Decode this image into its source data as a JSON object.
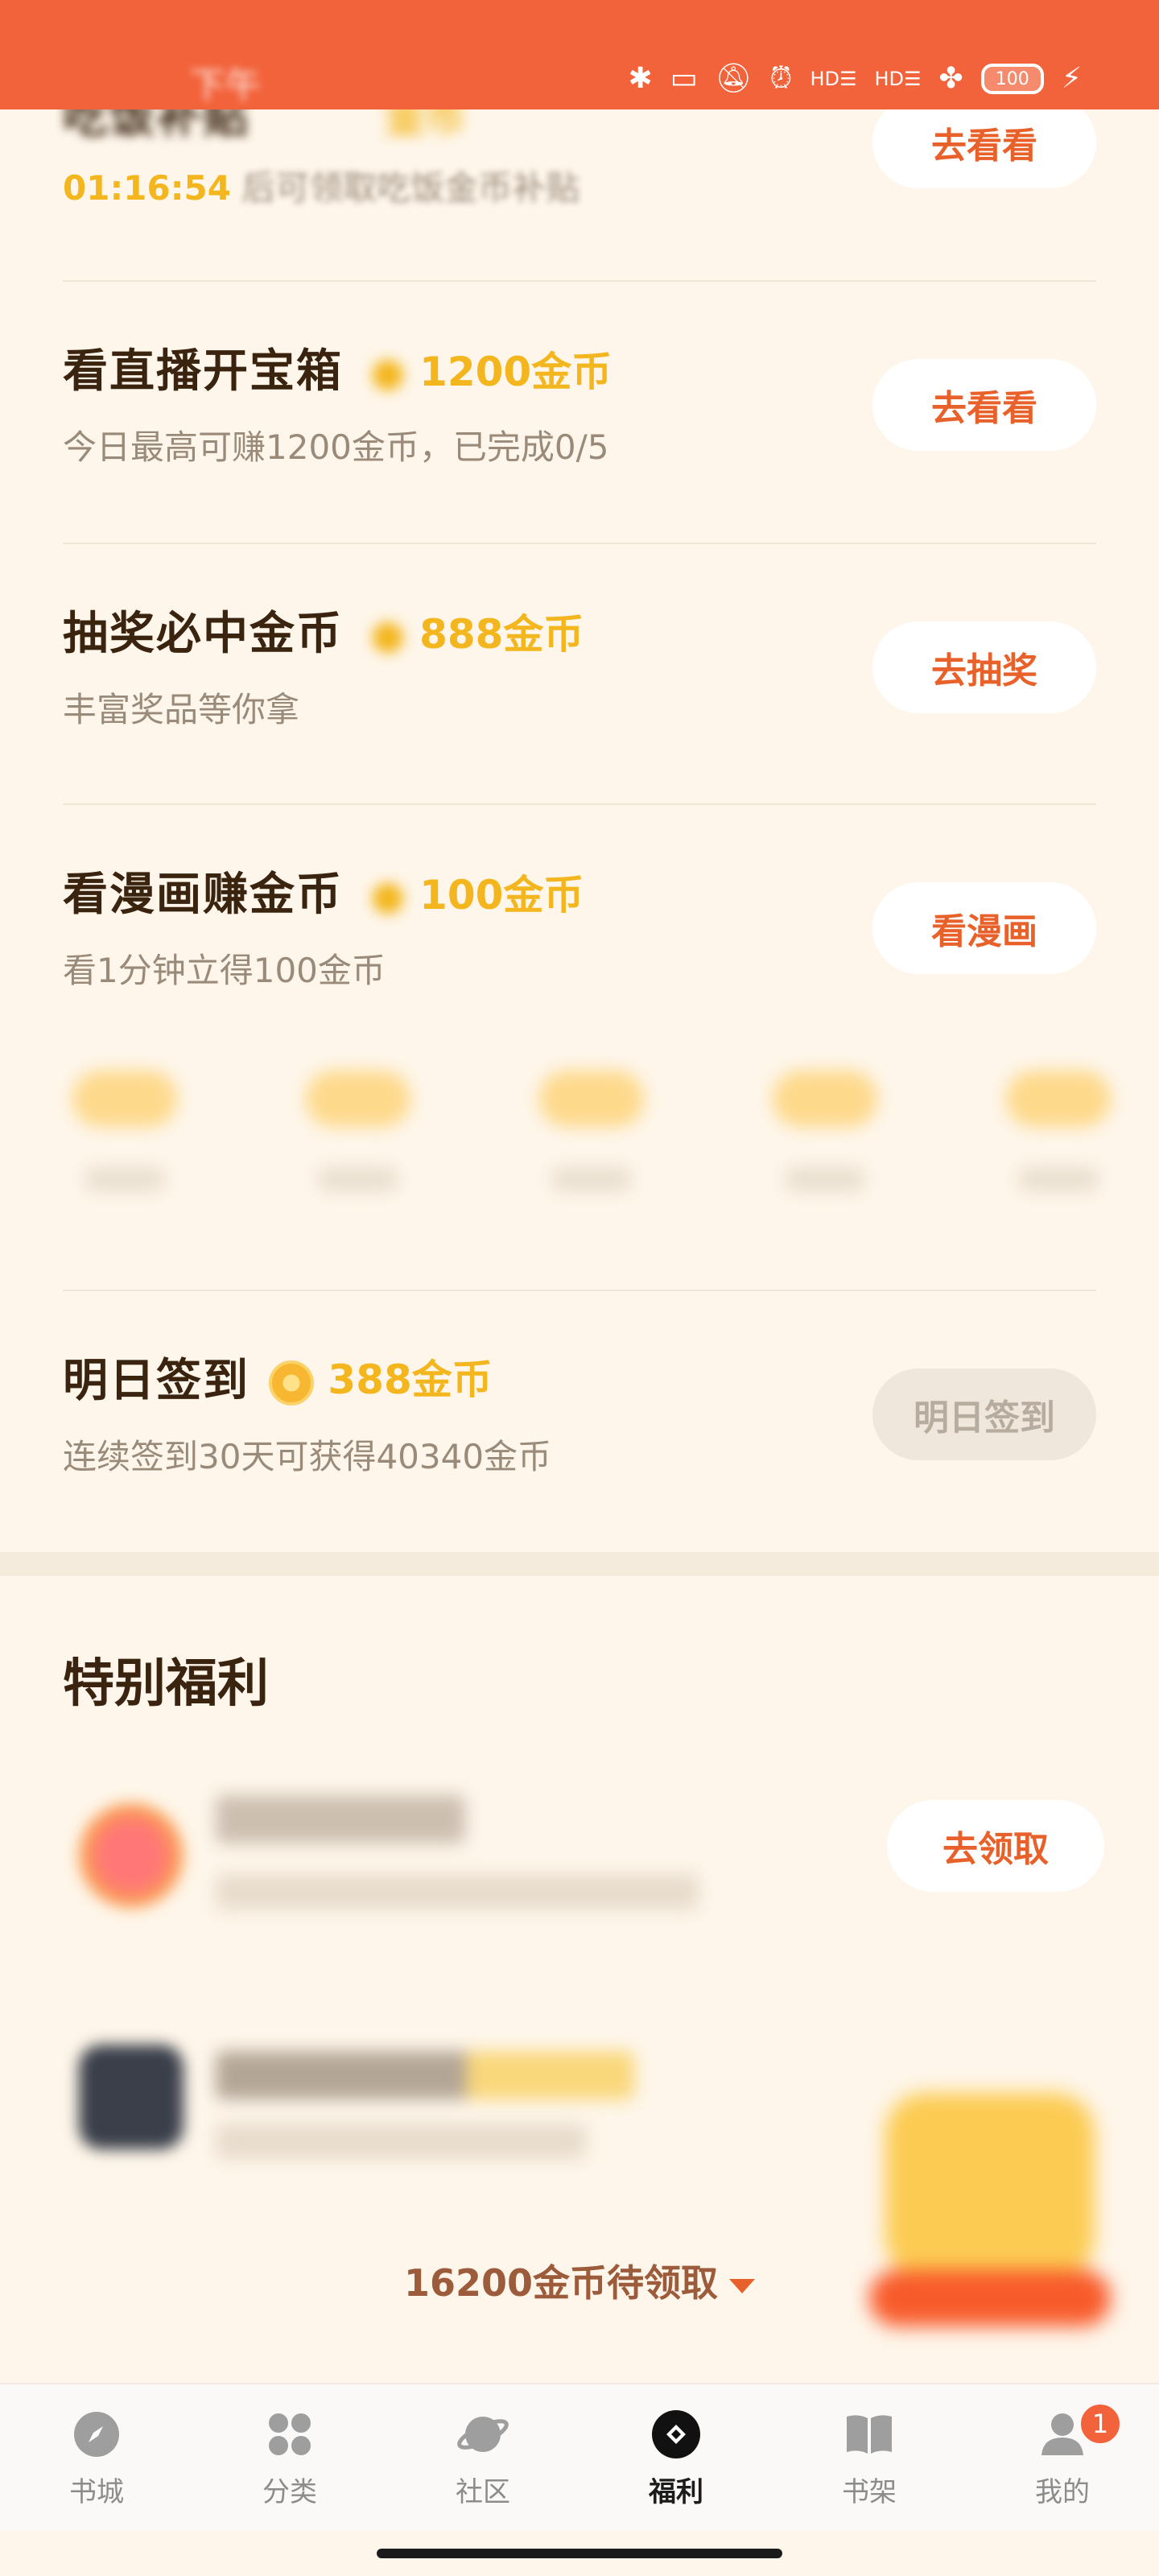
{
  "status_bar": {
    "time": "下午",
    "battery": "100",
    "icons": [
      "bluetooth-icon",
      "vibrate-icon",
      "mute-icon",
      "alarm-icon",
      "hd-signal-icon",
      "hd-signal-icon",
      "pinwheel-icon",
      "battery-icon",
      "charging-icon"
    ]
  },
  "tasks": [
    {
      "title": "吃饭补贴",
      "reward": "金币",
      "time": "01:16:54",
      "sub": "后可领取吃饭金币补贴",
      "button": "去看看"
    },
    {
      "title": "看直播开宝箱",
      "reward": "1200金币",
      "sub": "今日最高可赚1200金币，已完成0/5",
      "button": "去看看"
    },
    {
      "title": "抽奖必中金币",
      "reward": "888金币",
      "sub": "丰富奖品等你拿",
      "button": "去抽奖"
    },
    {
      "title": "看漫画赚金币",
      "reward": "100金币",
      "sub": "看1分钟立得100金币",
      "button": "看漫画"
    },
    {
      "title": "明日签到",
      "reward": "388金币",
      "sub": "连续签到30天可获得40340金币",
      "button": "明日签到"
    }
  ],
  "special": {
    "title": "特别福利",
    "item_button": "去领取"
  },
  "pending": "16200金币待领取",
  "nav": [
    {
      "label": "书城",
      "icon": "compass-icon"
    },
    {
      "label": "分类",
      "icon": "category-icon"
    },
    {
      "label": "社区",
      "icon": "planet-icon"
    },
    {
      "label": "福利",
      "icon": "welfare-icon"
    },
    {
      "label": "书架",
      "icon": "book-icon"
    },
    {
      "label": "我的",
      "icon": "profile-icon",
      "badge": "1"
    }
  ],
  "colors": {
    "accent": "#F2633B",
    "coin": "#F3B61E",
    "background": "#FEF6EA"
  }
}
